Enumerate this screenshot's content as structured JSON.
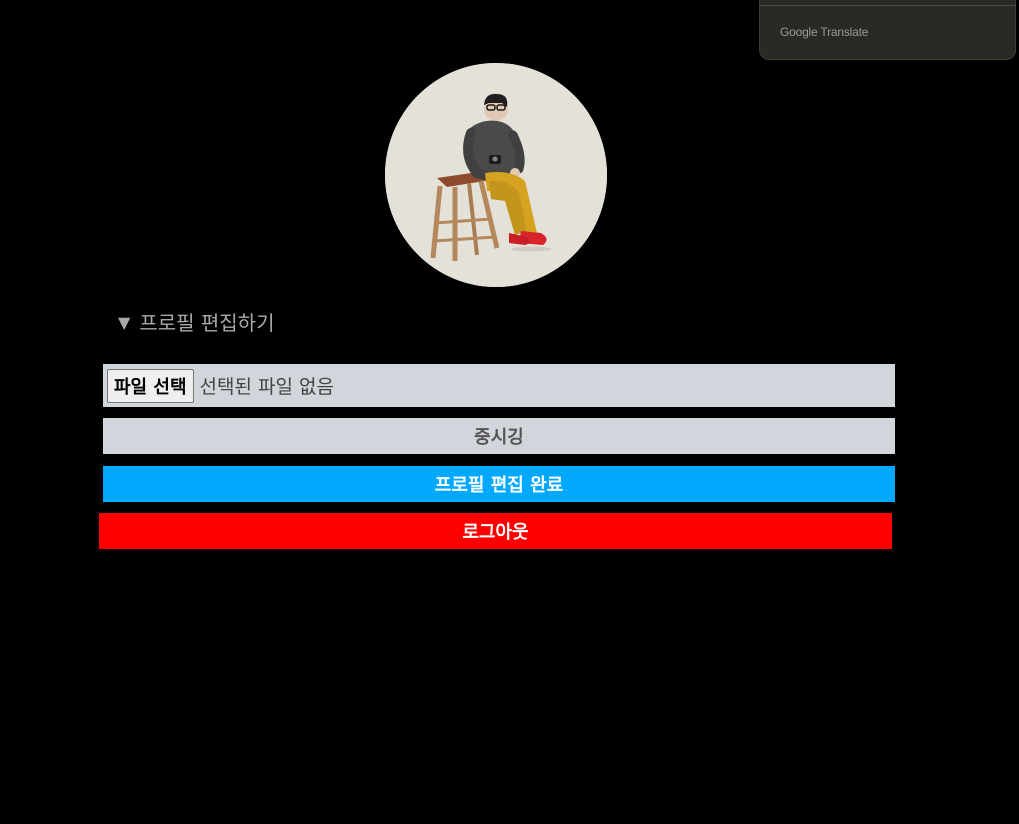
{
  "translate_popup": {
    "brand": "Google Translate"
  },
  "profile": {
    "avatar_icon": "profile-photo-illustration"
  },
  "edit_section": {
    "marker": "▼",
    "summary_label": "프로필 편집하기",
    "file_input": {
      "button_label": "파일 선택",
      "status": "선택된 파일 없음"
    },
    "nickname": {
      "value": "중시깅"
    },
    "complete_button": "프로필 편집 완료",
    "logout_button": "로그아웃"
  },
  "colors": {
    "background": "#000000",
    "field_bg": "#d1d5dc",
    "complete_bg": "#00a8ff",
    "logout_bg": "#ff0000",
    "summary_text": "#a9a9a9"
  }
}
